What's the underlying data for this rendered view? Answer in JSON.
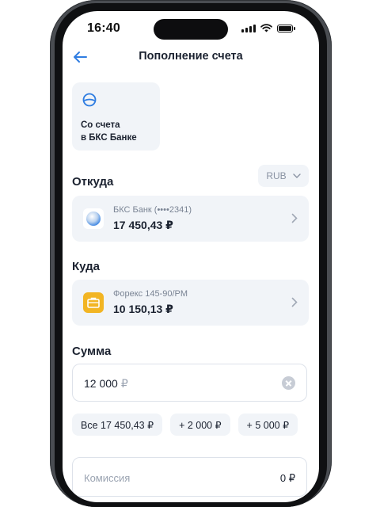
{
  "status_bar": {
    "time": "16:40"
  },
  "header": {
    "title": "Пополнение счета"
  },
  "source_tile": {
    "label": "Со счета\nв БКС Банке"
  },
  "from": {
    "section_label": "Откуда",
    "currency": "RUB",
    "account_name": "БКС Банк (••••2341)",
    "amount": "17 450,43 ₽"
  },
  "to": {
    "section_label": "Куда",
    "account_name": "Форекс 145-90/PM",
    "amount": "10 150,13 ₽"
  },
  "sum": {
    "section_label": "Сумма",
    "value": "12 000",
    "currency_symbol": "₽"
  },
  "quick_amounts": [
    "Все 17 450,43 ₽",
    "+ 2 000 ₽",
    "+ 5 000 ₽"
  ],
  "commission": {
    "label": "Комиссия",
    "value": "0 ₽"
  },
  "colors": {
    "accent": "#2f7de1",
    "card_bg": "#f1f4f8",
    "forex_icon": "#f2b523"
  }
}
